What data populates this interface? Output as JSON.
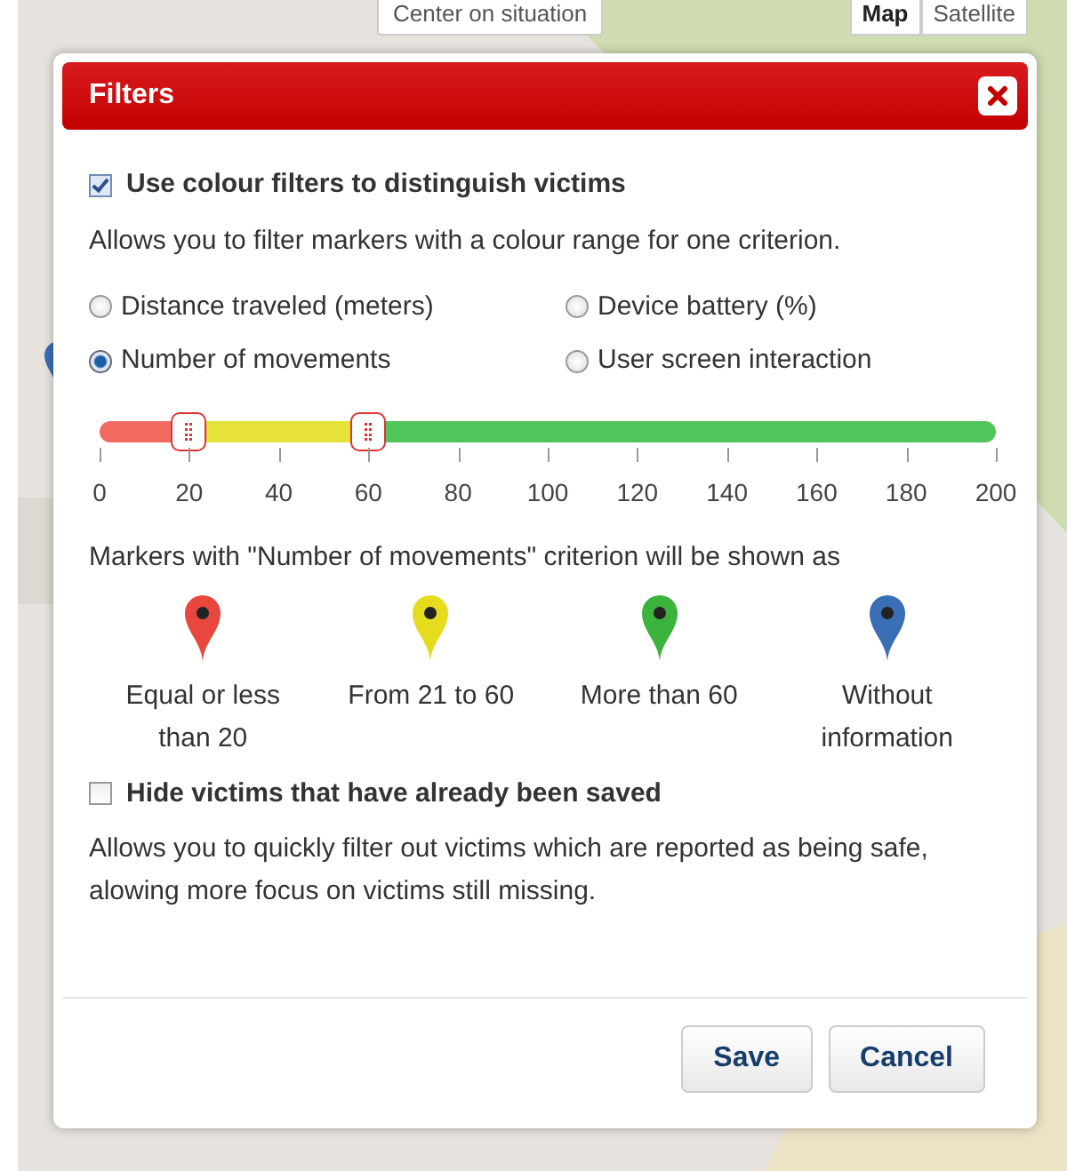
{
  "map_controls": {
    "center_button": "Center on situation",
    "map_types": [
      {
        "label": "Map",
        "selected": true
      },
      {
        "label": "Satellite",
        "selected": false
      }
    ]
  },
  "dialog": {
    "title": "Filters"
  },
  "colour_filter": {
    "label": "Use colour filters to distinguish victims",
    "checked": true,
    "description": "Allows you to filter markers with a colour range for one criterion."
  },
  "criteria": [
    {
      "label": "Distance traveled (meters)",
      "selected": false
    },
    {
      "label": "Device battery (%)",
      "selected": false
    },
    {
      "label": "Number of movements",
      "selected": true
    },
    {
      "label": "User screen interaction",
      "selected": false
    }
  ],
  "slider": {
    "handles": [
      {
        "level": 0.1
      },
      {
        "level": 0.3
      }
    ],
    "ticks": [
      "0",
      "20",
      "40",
      "60",
      "80",
      "100",
      "120",
      "140",
      "160",
      "180",
      "200"
    ]
  },
  "legend": {
    "caption": "Markers with \"Number of movements\" criterion will be shown as",
    "markers": [
      {
        "label": "Equal or less than 20",
        "color": "#e8473e"
      },
      {
        "label": "From 21 to 60",
        "color": "#e6dc1e"
      },
      {
        "label": "More than 60",
        "color": "#3cb33c"
      },
      {
        "label": "Without information",
        "color": "#3a6fb5"
      }
    ]
  },
  "hide_saved": {
    "label": "Hide victims that have already been saved",
    "checked": false,
    "description": "Allows you to quickly filter out victims which are reported as being safe, alowing more focus on victims still missing."
  },
  "buttons": [
    "Save",
    "Cancel"
  ]
}
